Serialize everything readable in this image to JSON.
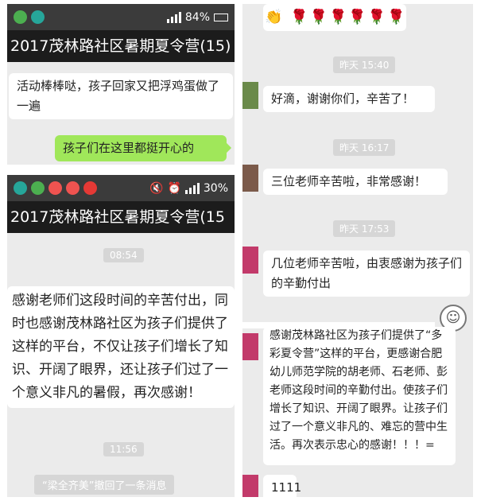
{
  "screen1": {
    "status_right": "84%",
    "title": "2017茂林路社区暑期夏令营(15)",
    "messages": [
      {
        "text": "活动棒棒哒，孩子回家又把浮鸡蛋做了一遍"
      },
      {
        "text": "孩子们在这里都挺开心的"
      }
    ]
  },
  "screen2": {
    "status_right": "30%",
    "title": "2017茂林路社区暑期夏令营(15",
    "time1": "08:54",
    "message": "感谢老师们这段时间的辛苦付出，同时也感谢茂林路社区为孩子们提供了这样的平台，不仅让孩子们增长了知识、开阔了眼界，还让孩子们过了一个意义非凡的暑假，再次感谢！",
    "time2": "11:56",
    "recall": "“梁全齐美”撤回了一条消息"
  },
  "screen3": {
    "flowers": "🌹🌹🌹🌹🌹🌹",
    "clap": "👏",
    "time1": "昨天 15:40",
    "msg1": "好滴，谢谢你们，辛苦了！",
    "time2": "昨天 16:17",
    "msg2": "三位老师辛苦啦，非常感谢！",
    "time3": "昨天 17:53",
    "msg3": "几位老师辛苦啦，由衷感谢为孩子们的辛勤付出",
    "msg4": "感谢茂林路社区为孩子们提供了“多彩夏令营”这样的平台，更感谢合肥幼儿师范学院的胡老师、石老师、彭老师这段时间的辛勤付出。使孩子们增长了知识、开阔了眼界。让孩子们过了一个意义非凡的、难忘的营中生活。再次表示忠心的感谢！！！=",
    "msg5": "1111"
  },
  "colors": {
    "statusbar": "#3b3b3b",
    "titlebar": "#1c1c1c",
    "chat_bg": "#ebebeb",
    "green_bubble": "#a0e75a"
  }
}
